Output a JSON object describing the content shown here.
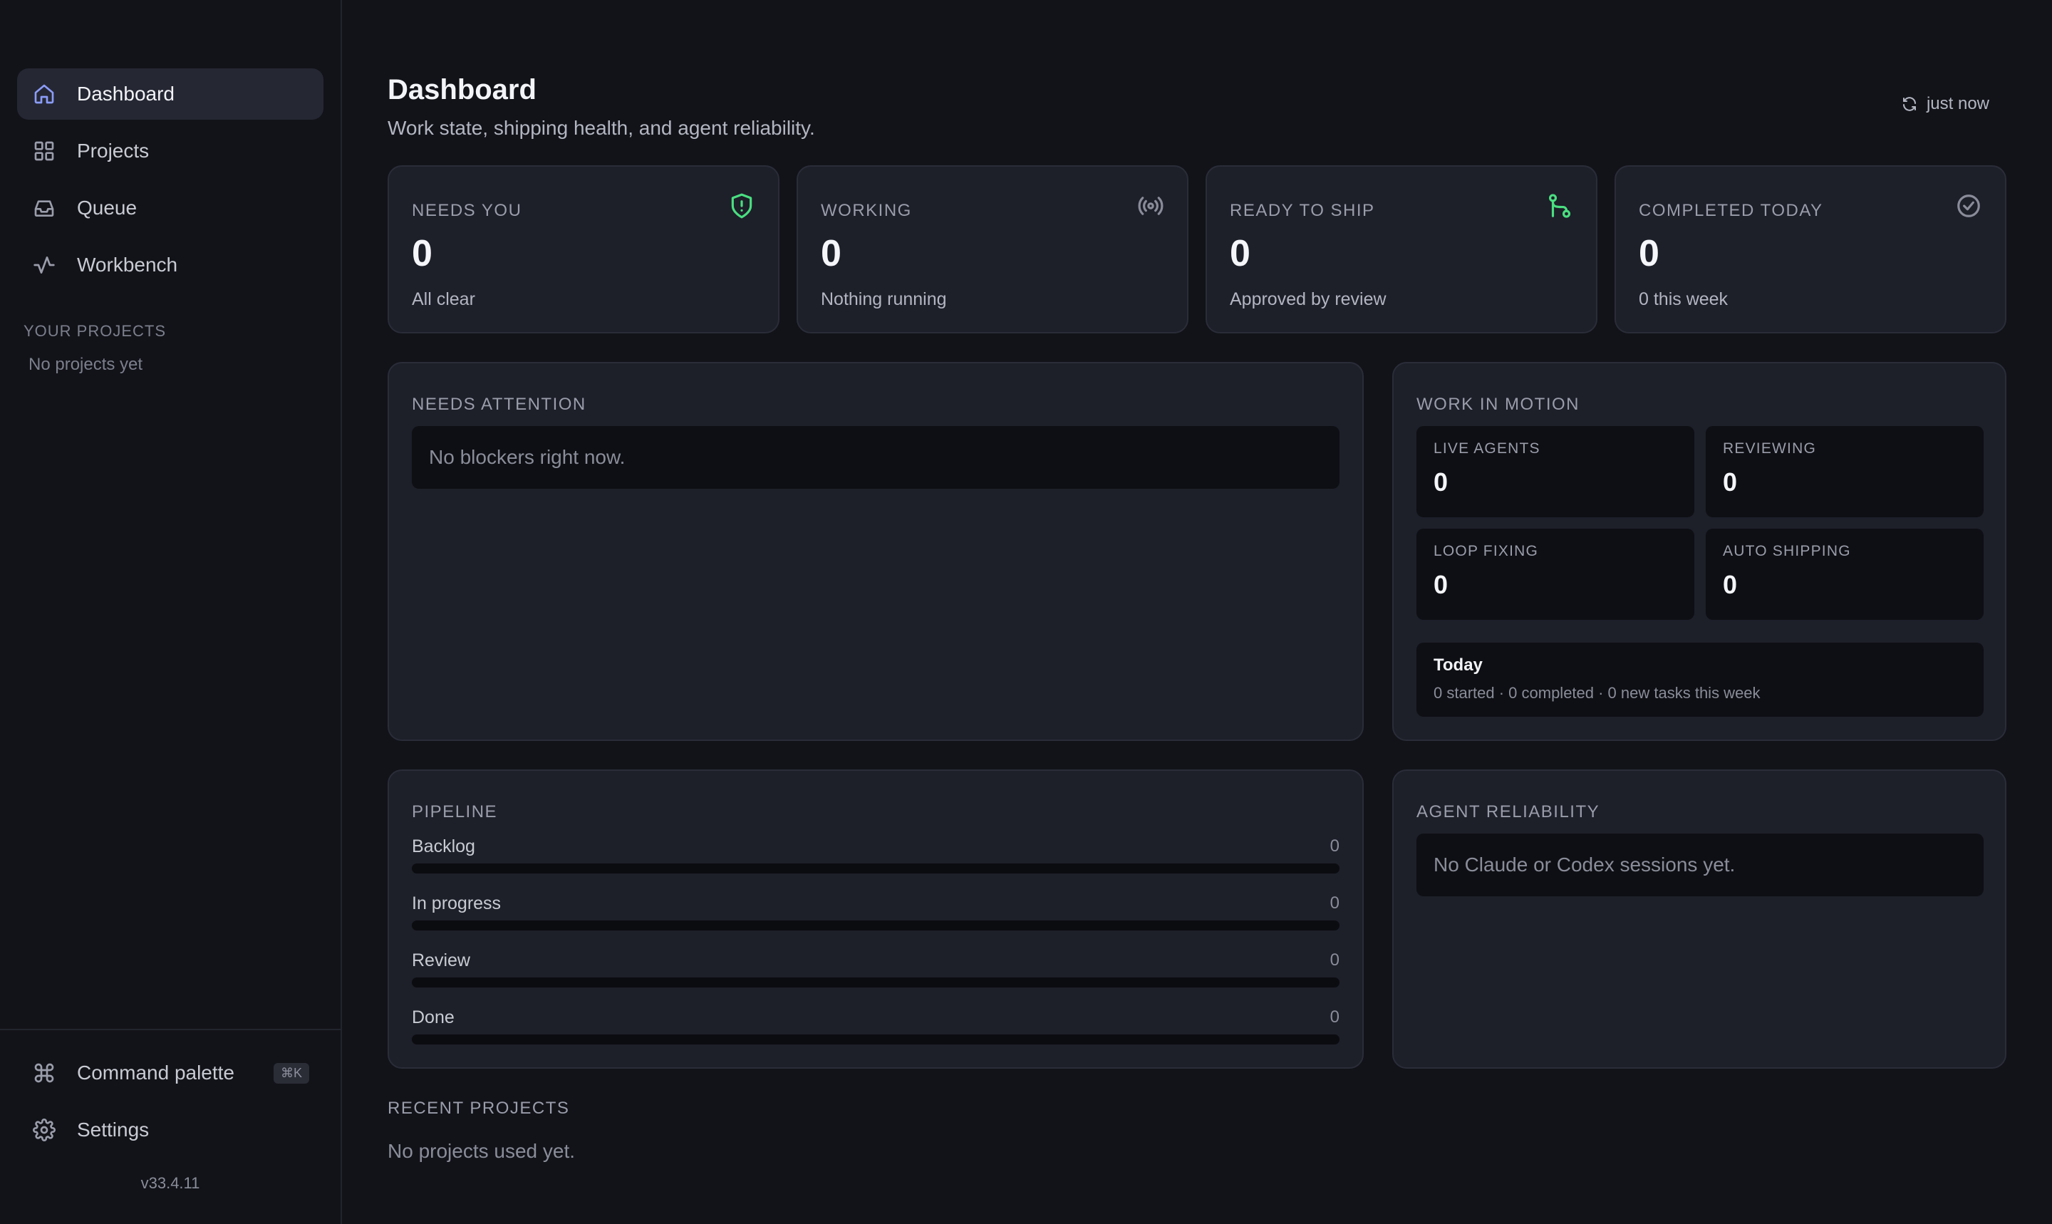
{
  "sidebar": {
    "nav": [
      {
        "label": "Dashboard",
        "icon": "home-icon",
        "active": true
      },
      {
        "label": "Projects",
        "icon": "grid-icon"
      },
      {
        "label": "Queue",
        "icon": "inbox-icon"
      },
      {
        "label": "Workbench",
        "icon": "activity-icon"
      }
    ],
    "section_title": "YOUR PROJECTS",
    "no_projects": "No projects yet",
    "bottom": {
      "command_palette": "Command palette",
      "command_shortcut": "⌘K",
      "settings": "Settings"
    },
    "version": "v33.4.11"
  },
  "header": {
    "title": "Dashboard",
    "subtitle": "Work state, shipping health, and agent reliability.",
    "refresh_label": "just now"
  },
  "stats": [
    {
      "label": "NEEDS YOU",
      "value": "0",
      "sub": "All clear",
      "icon": "shield-alert-icon",
      "icon_color": "#4ade80"
    },
    {
      "label": "WORKING",
      "value": "0",
      "sub": "Nothing running",
      "icon": "broadcast-icon",
      "icon_color": "#8a8d99"
    },
    {
      "label": "READY TO SHIP",
      "value": "0",
      "sub": "Approved by review",
      "icon": "git-pull-request-icon",
      "icon_color": "#4ade80"
    },
    {
      "label": "COMPLETED TODAY",
      "value": "0",
      "sub": "0 this week",
      "icon": "check-circle-icon",
      "icon_color": "#8a8d99"
    }
  ],
  "needs_attention": {
    "title": "NEEDS ATTENTION",
    "empty": "No blockers right now."
  },
  "work_in_motion": {
    "title": "WORK IN MOTION",
    "metrics": [
      {
        "label": "LIVE AGENTS",
        "value": "0"
      },
      {
        "label": "REVIEWING",
        "value": "0"
      },
      {
        "label": "LOOP FIXING",
        "value": "0"
      },
      {
        "label": "AUTO SHIPPING",
        "value": "0"
      }
    ],
    "today_title": "Today",
    "today_text": "0 started · 0 completed · 0 new tasks this week"
  },
  "pipeline": {
    "title": "PIPELINE",
    "rows": [
      {
        "label": "Backlog",
        "value": "0",
        "fraction": 0
      },
      {
        "label": "In progress",
        "value": "0",
        "fraction": 0
      },
      {
        "label": "Review",
        "value": "0",
        "fraction": 0
      },
      {
        "label": "Done",
        "value": "0",
        "fraction": 0
      }
    ]
  },
  "agent_reliability": {
    "title": "AGENT RELIABILITY",
    "empty": "No Claude or Codex sessions yet."
  },
  "recent_projects": {
    "title": "RECENT PROJECTS",
    "empty": "No projects used yet."
  },
  "colors": {
    "accent": "#8b9cf7",
    "success": "#4ade80",
    "background": "#121319",
    "card": "#1d1f29"
  }
}
